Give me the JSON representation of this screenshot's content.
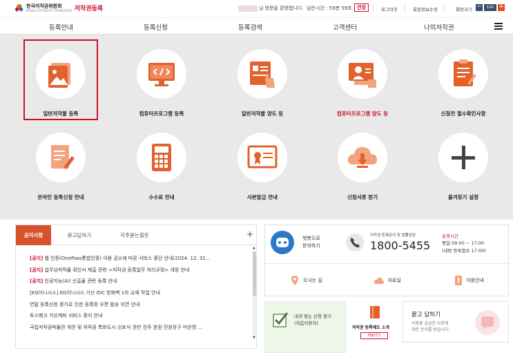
{
  "header": {
    "org_name": "한국저작권위원회",
    "org_sub": "KOREA COPYRIGHT COMMISSION",
    "service_name": "저작권등록",
    "welcome_text": "님 방문을 환영합니다.",
    "remaining_time": "남은시간 : 59분 59초",
    "extend_label": "연장",
    "logout_label": "로그아웃",
    "profile_label": "회원정보수정",
    "zoom_label": "화면크기",
    "zoom_minus": "−",
    "zoom_value": "100",
    "zoom_plus": "+"
  },
  "nav": {
    "items": [
      {
        "label": "등록안내"
      },
      {
        "label": "등록신청"
      },
      {
        "label": "등록검색"
      },
      {
        "label": "고객센터"
      },
      {
        "label": "나의저작권"
      }
    ]
  },
  "tiles": [
    {
      "label": "일반저작물 등록",
      "icon": "image-file-icon",
      "highlight": true
    },
    {
      "label": "컴퓨터프로그램 등록",
      "icon": "code-monitor-icon"
    },
    {
      "label": "일반저작물 양도 등",
      "icon": "document-hand-icon"
    },
    {
      "label": "컴퓨터프로그램 양도 등",
      "icon": "code-monitor-hand-icon",
      "red": true
    },
    {
      "label": "신청전 필수확인사항",
      "icon": "checklist-pen-icon"
    },
    {
      "label": "온라인 등록신청 안내",
      "icon": "document-pen-icon"
    },
    {
      "label": "수수료 안내",
      "icon": "calculator-icon"
    },
    {
      "label": "사본발급 안내",
      "icon": "certificate-icon"
    },
    {
      "label": "신청서류 받기",
      "icon": "cloud-download-icon"
    },
    {
      "label": "즐겨찾기 설정",
      "icon": "plus-icon"
    }
  ],
  "notice": {
    "tabs": [
      "공지사항",
      "묻고답하기",
      "자주묻는질문"
    ],
    "more": "+",
    "items": [
      {
        "tag": "[공지]",
        "text": " 웹 인증(OnePass통합인증) 이용 감소에 따른 서비스 중단 안내(2024. 12. 31..."
      },
      {
        "tag": "[공지]",
        "text": " 업무상저작물 확인서 제출 관련 <저작권 등록업무 처리규정> 개정 안내"
      },
      {
        "tag": "[공지]",
        "text": " 인공지능(AI) 산출물 관련 등록 안내"
      },
      {
        "tag": "",
        "text": "[KG이니시스] KG이니시스 가산 IDC 방화벽 1차 교체 작업 안내"
      },
      {
        "tag": "",
        "text": "연말 등록신청 증가로 인한 등록증 우편 발송 지연 안내"
      },
      {
        "tag": "",
        "text": "토스뱅크 가상계좌 서비스 중지 안내"
      },
      {
        "tag": "",
        "text": "국립저작권박물관 개관 및 저작권 특화도시 선포식 관련 진주 본원 민원창구 미운영 ..."
      }
    ]
  },
  "right": {
    "chatbot_1": "챗봇으로",
    "chatbot_2": "문의하기",
    "phone_desc": "저작권 등록문의 및 법률상담",
    "phone_number": "1800-5455",
    "hours_title": "운영시간",
    "hours_1": "평일 09:00 ~ 17:00",
    "hours_2": "(내방 등록접수 17:00)",
    "link_directions": "오시는 길",
    "link_library": "자료실",
    "link_guide": "이용안내",
    "service_1": "내게 맞는 신청 찾기",
    "service_2": "(처음이용자)",
    "intro_title": "저작권 등록제도 소개",
    "intro_btn": "바로가기",
    "qa_title": "묻고 답하기",
    "qa_1": "이용중 궁금한 사항에",
    "qa_2": "대한 문의를 받습니다."
  }
}
